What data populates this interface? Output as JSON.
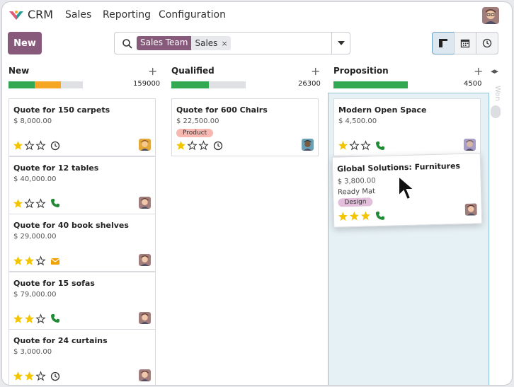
{
  "app": {
    "name": "CRM",
    "brand_color": "#875a7b"
  },
  "menu": [
    "Sales",
    "Reporting",
    "Configuration"
  ],
  "control": {
    "new_label": "New",
    "facet_label": "Sales Team",
    "facet_value": "Sales",
    "facet_remove": "×"
  },
  "columns": [
    {
      "name": "New",
      "total": "159000",
      "progress": {
        "green": 0.35,
        "orange": 0.35
      },
      "cards": [
        {
          "title": "Quote for 150 carpets",
          "amount": "$ 8,000.00",
          "stars": 1,
          "activity": "clock-icon"
        },
        {
          "title": "Quote for 12 tables",
          "amount": "$ 40,000.00",
          "stars": 1,
          "activity": "phone-icon"
        },
        {
          "title": "Quote for 40 book shelves",
          "amount": "$ 29,000.00",
          "stars": 2,
          "activity": "envelope-icon"
        },
        {
          "title": "Quote for 15 sofas",
          "amount": "$ 79,000.00",
          "stars": 2,
          "activity": "phone-icon"
        },
        {
          "title": "Quote for 24 curtains",
          "amount": "$ 3,000.00",
          "stars": 2,
          "activity": "clock-icon"
        }
      ]
    },
    {
      "name": "Qualified",
      "total": "26300",
      "progress": {
        "green": 0.5,
        "orange": 0
      },
      "cards": [
        {
          "title": "Quote for 600 Chairs",
          "amount": "$ 22,500.00",
          "tag": "Product",
          "tag_color": "#f6b8b0",
          "stars": 1,
          "activity": "clock-icon"
        }
      ]
    },
    {
      "name": "Proposition",
      "total": "4500",
      "progress": {
        "green": 1.0,
        "orange": 0
      },
      "cards": [
        {
          "title": "Modern Open Space",
          "amount": "$ 4,500.00",
          "stars": 1,
          "activity": "phone-icon"
        }
      ]
    }
  ],
  "dragged_card": {
    "title": "Global Solutions: Furnitures",
    "amount": "$ 3,800.00",
    "subtitle": "Ready Mat",
    "tag": "Design",
    "tag_color": "#e3bfdc",
    "stars": 3,
    "activity": "phone-icon"
  },
  "folded_column": {
    "name": "Won"
  },
  "colors": {
    "green": "#33a852",
    "orange": "#f6a623",
    "star": "#f3c400",
    "phone": "#1f8b34",
    "envelope": "#f0a000"
  }
}
